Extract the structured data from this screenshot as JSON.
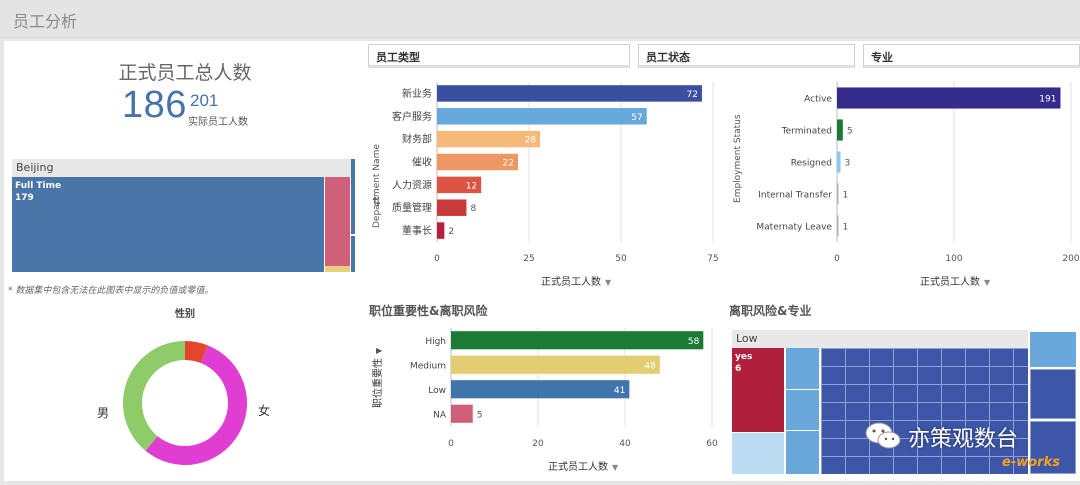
{
  "app": {
    "title": "员工分析"
  },
  "kpi": {
    "title": "正式员工总人数",
    "main": "186",
    "sub": "201",
    "sub_label": "实际员工人数"
  },
  "treemap_location": {
    "header": "Beijing",
    "cell_label": "Full Time",
    "cell_value": "179"
  },
  "note": "* 数据集中包含无法在此图表中显示的负值或零值。",
  "gender": {
    "title": "性别",
    "labels": {
      "male": "男",
      "female": "女"
    },
    "chart_data": {
      "type": "pie",
      "categories": [
        "女",
        "男",
        "other"
      ],
      "values": [
        0.55,
        0.39,
        0.06
      ],
      "colors": [
        "#e03dd2",
        "#90cb6a",
        "#e5442f"
      ]
    }
  },
  "filters": {
    "employee_type": "员工类型",
    "employee_status": "员工状态",
    "major": "专业"
  },
  "dept_chart": {
    "chart_data": {
      "type": "bar",
      "orientation": "horizontal",
      "categories": [
        "新业务",
        "客户服务",
        "财务部",
        "催收",
        "人力资源",
        "质量管理",
        "董事长"
      ],
      "values": [
        72,
        57,
        28,
        22,
        12,
        8,
        2
      ],
      "colors": [
        "#3a4fa0",
        "#68a9db",
        "#f7b97a",
        "#ef9763",
        "#dd5443",
        "#c93a3a",
        "#b82040"
      ],
      "xlabel": "正式员工人数",
      "ylabel": "Department Name",
      "xlim": [
        0,
        75
      ],
      "xticks": [
        "0",
        "25",
        "50",
        "75"
      ]
    }
  },
  "status_chart": {
    "chart_data": {
      "type": "bar",
      "orientation": "horizontal",
      "categories": [
        "Active",
        "Terminated",
        "Resigned",
        "Internal Transfer",
        "Maternaty Leave"
      ],
      "values": [
        191,
        5,
        3,
        1,
        1
      ],
      "colors": [
        "#352b8c",
        "#1b7a33",
        "#8fc6ec",
        "#b0b0b0",
        "#b0b0b0"
      ],
      "xlabel": "正式员工人数",
      "ylabel": "Employment Status",
      "xlim": [
        0,
        200
      ],
      "xticks": [
        "0",
        "100",
        "200"
      ]
    }
  },
  "risk_section": {
    "title": "职位重要性&离职风险"
  },
  "risk_chart": {
    "chart_data": {
      "type": "bar",
      "orientation": "horizontal",
      "categories": [
        "High",
        "Medium",
        "Low",
        "NA"
      ],
      "values": [
        58,
        48,
        41,
        5
      ],
      "colors": [
        "#1b7a33",
        "#e3cd72",
        "#3f74ac",
        "#d0607a"
      ],
      "xlabel": "正式员工人数",
      "ylabel": "职位重要性",
      "xlim": [
        0,
        60
      ],
      "xticks": [
        "0",
        "20",
        "40",
        "60"
      ]
    }
  },
  "risk_major": {
    "title": "离职风险&专业",
    "header": "Low",
    "cell_label": "yes",
    "cell_value": "6"
  },
  "logo": {
    "text": "亦策观数台",
    "watermark": "e-works"
  },
  "icons": {
    "sort": "sort-desc-icon",
    "wechat": "wechat-icon",
    "dropdown": "caret-down-icon"
  }
}
